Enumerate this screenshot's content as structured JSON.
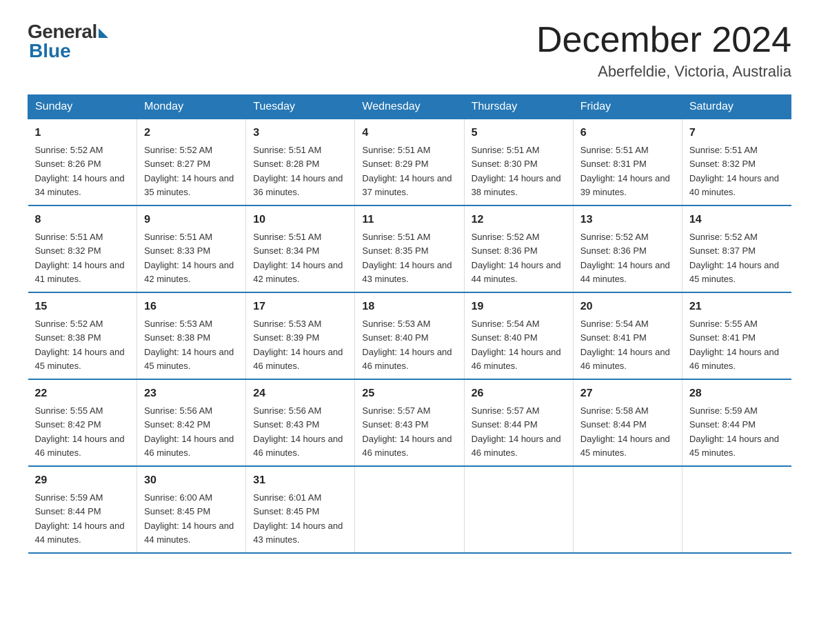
{
  "header": {
    "logo_general": "General",
    "logo_blue": "Blue",
    "main_title": "December 2024",
    "subtitle": "Aberfeldie, Victoria, Australia"
  },
  "days_of_week": [
    "Sunday",
    "Monday",
    "Tuesday",
    "Wednesday",
    "Thursday",
    "Friday",
    "Saturday"
  ],
  "weeks": [
    [
      {
        "day": "1",
        "sunrise": "5:52 AM",
        "sunset": "8:26 PM",
        "daylight": "14 hours and 34 minutes."
      },
      {
        "day": "2",
        "sunrise": "5:52 AM",
        "sunset": "8:27 PM",
        "daylight": "14 hours and 35 minutes."
      },
      {
        "day": "3",
        "sunrise": "5:51 AM",
        "sunset": "8:28 PM",
        "daylight": "14 hours and 36 minutes."
      },
      {
        "day": "4",
        "sunrise": "5:51 AM",
        "sunset": "8:29 PM",
        "daylight": "14 hours and 37 minutes."
      },
      {
        "day": "5",
        "sunrise": "5:51 AM",
        "sunset": "8:30 PM",
        "daylight": "14 hours and 38 minutes."
      },
      {
        "day": "6",
        "sunrise": "5:51 AM",
        "sunset": "8:31 PM",
        "daylight": "14 hours and 39 minutes."
      },
      {
        "day": "7",
        "sunrise": "5:51 AM",
        "sunset": "8:32 PM",
        "daylight": "14 hours and 40 minutes."
      }
    ],
    [
      {
        "day": "8",
        "sunrise": "5:51 AM",
        "sunset": "8:32 PM",
        "daylight": "14 hours and 41 minutes."
      },
      {
        "day": "9",
        "sunrise": "5:51 AM",
        "sunset": "8:33 PM",
        "daylight": "14 hours and 42 minutes."
      },
      {
        "day": "10",
        "sunrise": "5:51 AM",
        "sunset": "8:34 PM",
        "daylight": "14 hours and 42 minutes."
      },
      {
        "day": "11",
        "sunrise": "5:51 AM",
        "sunset": "8:35 PM",
        "daylight": "14 hours and 43 minutes."
      },
      {
        "day": "12",
        "sunrise": "5:52 AM",
        "sunset": "8:36 PM",
        "daylight": "14 hours and 44 minutes."
      },
      {
        "day": "13",
        "sunrise": "5:52 AM",
        "sunset": "8:36 PM",
        "daylight": "14 hours and 44 minutes."
      },
      {
        "day": "14",
        "sunrise": "5:52 AM",
        "sunset": "8:37 PM",
        "daylight": "14 hours and 45 minutes."
      }
    ],
    [
      {
        "day": "15",
        "sunrise": "5:52 AM",
        "sunset": "8:38 PM",
        "daylight": "14 hours and 45 minutes."
      },
      {
        "day": "16",
        "sunrise": "5:53 AM",
        "sunset": "8:38 PM",
        "daylight": "14 hours and 45 minutes."
      },
      {
        "day": "17",
        "sunrise": "5:53 AM",
        "sunset": "8:39 PM",
        "daylight": "14 hours and 46 minutes."
      },
      {
        "day": "18",
        "sunrise": "5:53 AM",
        "sunset": "8:40 PM",
        "daylight": "14 hours and 46 minutes."
      },
      {
        "day": "19",
        "sunrise": "5:54 AM",
        "sunset": "8:40 PM",
        "daylight": "14 hours and 46 minutes."
      },
      {
        "day": "20",
        "sunrise": "5:54 AM",
        "sunset": "8:41 PM",
        "daylight": "14 hours and 46 minutes."
      },
      {
        "day": "21",
        "sunrise": "5:55 AM",
        "sunset": "8:41 PM",
        "daylight": "14 hours and 46 minutes."
      }
    ],
    [
      {
        "day": "22",
        "sunrise": "5:55 AM",
        "sunset": "8:42 PM",
        "daylight": "14 hours and 46 minutes."
      },
      {
        "day": "23",
        "sunrise": "5:56 AM",
        "sunset": "8:42 PM",
        "daylight": "14 hours and 46 minutes."
      },
      {
        "day": "24",
        "sunrise": "5:56 AM",
        "sunset": "8:43 PM",
        "daylight": "14 hours and 46 minutes."
      },
      {
        "day": "25",
        "sunrise": "5:57 AM",
        "sunset": "8:43 PM",
        "daylight": "14 hours and 46 minutes."
      },
      {
        "day": "26",
        "sunrise": "5:57 AM",
        "sunset": "8:44 PM",
        "daylight": "14 hours and 46 minutes."
      },
      {
        "day": "27",
        "sunrise": "5:58 AM",
        "sunset": "8:44 PM",
        "daylight": "14 hours and 45 minutes."
      },
      {
        "day": "28",
        "sunrise": "5:59 AM",
        "sunset": "8:44 PM",
        "daylight": "14 hours and 45 minutes."
      }
    ],
    [
      {
        "day": "29",
        "sunrise": "5:59 AM",
        "sunset": "8:44 PM",
        "daylight": "14 hours and 44 minutes."
      },
      {
        "day": "30",
        "sunrise": "6:00 AM",
        "sunset": "8:45 PM",
        "daylight": "14 hours and 44 minutes."
      },
      {
        "day": "31",
        "sunrise": "6:01 AM",
        "sunset": "8:45 PM",
        "daylight": "14 hours and 43 minutes."
      },
      null,
      null,
      null,
      null
    ]
  ]
}
